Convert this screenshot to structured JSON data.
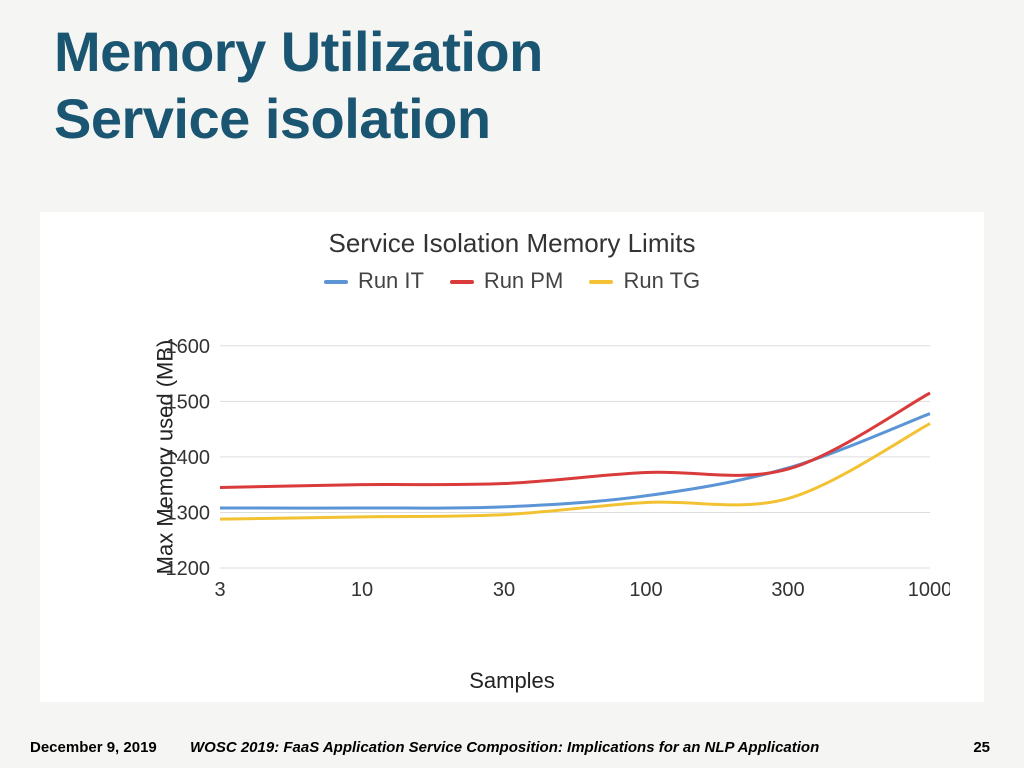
{
  "slide": {
    "title_line1": "Memory Utilization",
    "title_line2": "Service isolation"
  },
  "chart_data": {
    "type": "line",
    "title": "Service Isolation Memory Limits",
    "xlabel": "Samples",
    "ylabel": "Max Memory used (MB)",
    "x_ticks": [
      "3",
      "10",
      "30",
      "100",
      "300",
      "1000"
    ],
    "y_ticks": [
      1200,
      1300,
      1400,
      1500,
      1600
    ],
    "ylim": [
      1200,
      1650
    ],
    "categories": [
      3,
      10,
      30,
      100,
      300,
      1000
    ],
    "series": [
      {
        "name": "Run IT",
        "color": "#5b95d6",
        "values": [
          1308,
          1308,
          1310,
          1330,
          1380,
          1478
        ]
      },
      {
        "name": "Run PM",
        "color": "#d93b3b",
        "values": [
          1345,
          1350,
          1352,
          1372,
          1378,
          1515
        ]
      },
      {
        "name": "Run TG",
        "color": "#f2c233",
        "values": [
          1288,
          1292,
          1296,
          1318,
          1325,
          1460
        ]
      }
    ]
  },
  "footer": {
    "date": "December 9, 2019",
    "conference": "WOSC 2019: FaaS Application Service Composition: Implications for an NLP Application",
    "page": "25"
  }
}
